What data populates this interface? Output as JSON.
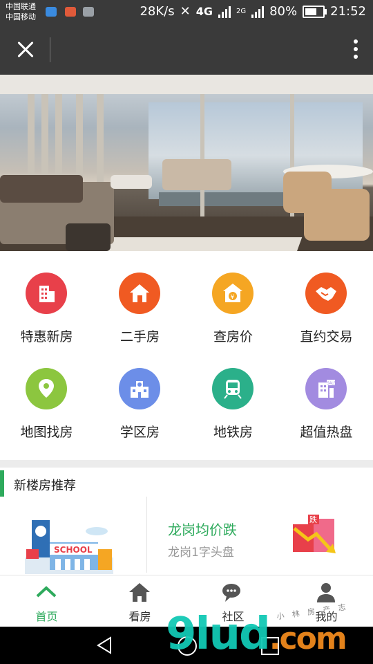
{
  "status_bar": {
    "carrier1": "中国联通",
    "carrier2": "中国移动",
    "speed": "28K/s",
    "network": "4G",
    "network2": "2G",
    "battery": "80%",
    "battery_level": 0.8,
    "time": "21:52"
  },
  "banner": {
    "description_icon": "living-room-photo"
  },
  "menu": [
    {
      "label": "特惠新房",
      "color": "#e8404a",
      "icon": "building-icon"
    },
    {
      "label": "二手房",
      "color": "#f05a22",
      "icon": "house-icon"
    },
    {
      "label": "查房价",
      "color": "#f5a623",
      "icon": "price-house-icon"
    },
    {
      "label": "直约交易",
      "color": "#f05a22",
      "icon": "handshake-icon"
    },
    {
      "label": "地图找房",
      "color": "#8cc63f",
      "icon": "map-pin-icon"
    },
    {
      "label": "学区房",
      "color": "#6c8ee8",
      "icon": "school-icon"
    },
    {
      "label": "地铁房",
      "color": "#2bb08a",
      "icon": "subway-icon"
    },
    {
      "label": "超值热盘",
      "color": "#a28be0",
      "icon": "sale-building-icon"
    }
  ],
  "recommend": {
    "title": "新楼房推荐",
    "item_title": "龙岗均价跌",
    "item_subtitle": "龙岗1字头盘",
    "school_sign": "SCHOOL",
    "price_tag": "跌"
  },
  "tabs": [
    {
      "label": "首页",
      "icon": "home-chevron-icon",
      "active": true
    },
    {
      "label": "看房",
      "icon": "house-icon",
      "active": false
    },
    {
      "label": "社区",
      "icon": "chat-bubbles-icon",
      "active": false
    },
    {
      "label": "我的",
      "icon": "user-icon",
      "active": false
    }
  ],
  "watermark": {
    "main": "9lud",
    "suffix": ".com",
    "small": "小 林 房 产 志"
  },
  "colors": {
    "accent": "#2eaa5c",
    "toolbar": "#3a3a3a"
  }
}
